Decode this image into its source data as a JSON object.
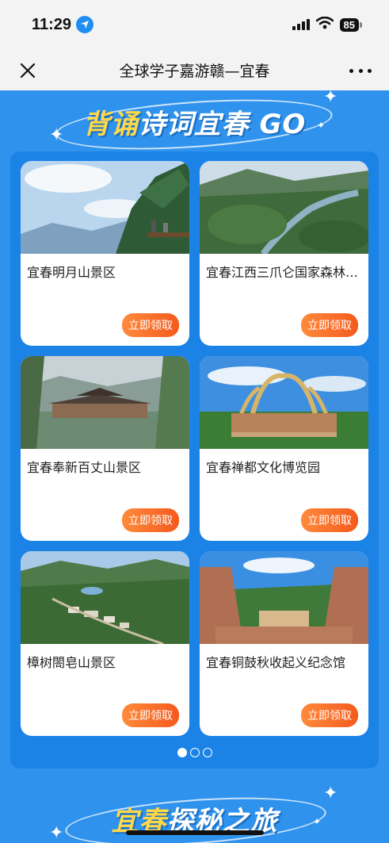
{
  "status_bar": {
    "time": "11:29",
    "battery": "85"
  },
  "nav": {
    "title": "全球学子嘉游赣—宜春"
  },
  "banner": {
    "part1": "背诵",
    "part2": "诗词宜春 GO"
  },
  "cards": [
    {
      "name": "宜春明月山景区",
      "button": "立即领取"
    },
    {
      "name": "宜春江西三爪仑国家森林公园",
      "button": "立即领取"
    },
    {
      "name": "宜春奉新百丈山景区",
      "button": "立即领取"
    },
    {
      "name": "宜春禅都文化博览园",
      "button": "立即领取"
    },
    {
      "name": "樟树閤皂山景区",
      "button": "立即领取"
    },
    {
      "name": "宜春铜鼓秋收起义纪念馆",
      "button": "立即领取"
    }
  ],
  "pager": {
    "total": 3,
    "active": 1
  },
  "footer_banner": {
    "part1": "宜春",
    "part2": "探秘之旅"
  },
  "colors": {
    "background": "#2f93ee",
    "panel": "#1c83e6",
    "button": "#f45a1d",
    "title_yellow": "#ffd84a"
  }
}
